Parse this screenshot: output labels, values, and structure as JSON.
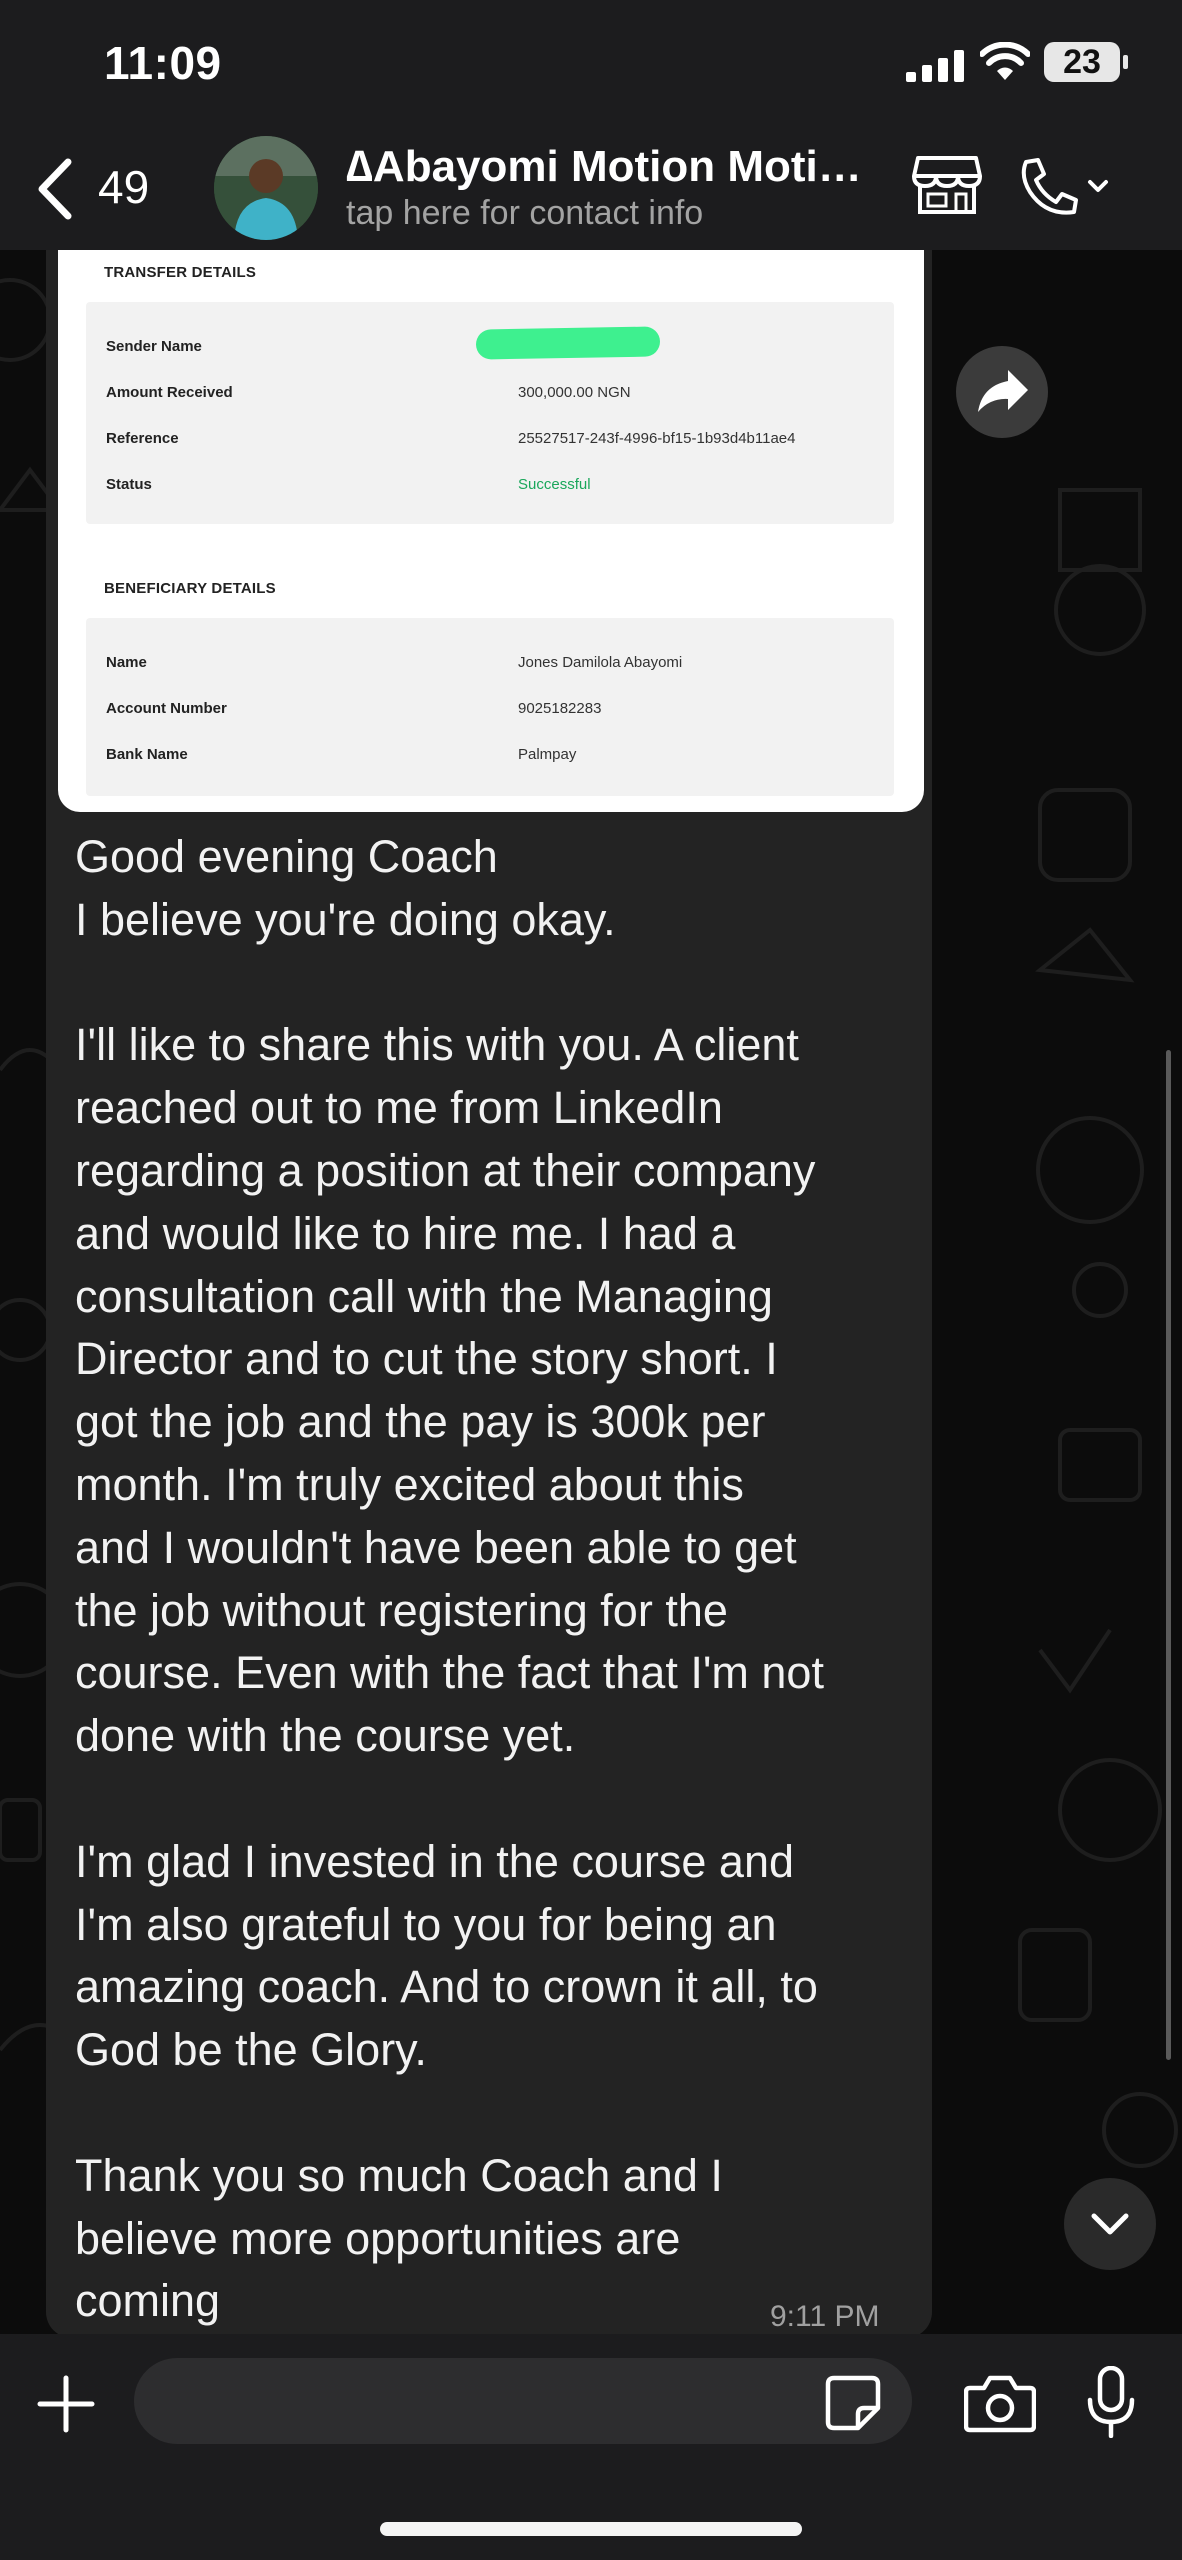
{
  "status_bar": {
    "time": "11:09",
    "battery": "23"
  },
  "header": {
    "back_count": "49",
    "contact_name": "∆Abayomi Motion Motion…",
    "contact_subtitle": "tap here for contact info"
  },
  "receipt": {
    "transfer_heading": "TRANSFER DETAILS",
    "transfer_rows": [
      {
        "label": "Sender Name",
        "value": ""
      },
      {
        "label": "Amount Received",
        "value": "300,000.00 NGN"
      },
      {
        "label": "Reference",
        "value": "25527517-243f-4996-bf15-1b93d4b11ae4"
      },
      {
        "label": "Status",
        "value": "Successful"
      }
    ],
    "beneficiary_heading": "BENEFICIARY DETAILS",
    "beneficiary_rows": [
      {
        "label": "Name",
        "value": "Jones Damilola Abayomi"
      },
      {
        "label": "Account Number",
        "value": "9025182283"
      },
      {
        "label": "Bank Name",
        "value": "Palmpay"
      }
    ],
    "status_color": "#1aa75b",
    "redaction_color": "#3ef08f"
  },
  "message": {
    "text": "Good evening Coach\nI believe you're doing okay.\n\nI'll like to share this with you. A client\nreached out to me from LinkedIn\nregarding a position at their company\nand would like to hire me. I had a\nconsultation call with the Managing\nDirector and to cut the story short. I\ngot the job and the pay is 300k per\nmonth. I'm truly excited about this\nand I wouldn't have been able to get\nthe job without registering for the\ncourse. Even with the fact that I'm not\ndone with the course yet.\n\nI'm glad I invested in the course and\nI'm also grateful to you for being an\namazing coach. And to crown it all, to\nGod be the Glory.\n\nThank you so much Coach and I\nbelieve more opportunities are\ncoming",
    "time": "9:11 PM"
  },
  "input": {
    "placeholder": "",
    "value": ""
  },
  "icons": [
    "back-chevron-icon",
    "avatar",
    "store-icon",
    "phone-icon",
    "chevron-down-icon",
    "forward-icon",
    "scroll-down-icon",
    "plus-icon",
    "sticker-icon",
    "camera-icon",
    "mic-icon"
  ]
}
